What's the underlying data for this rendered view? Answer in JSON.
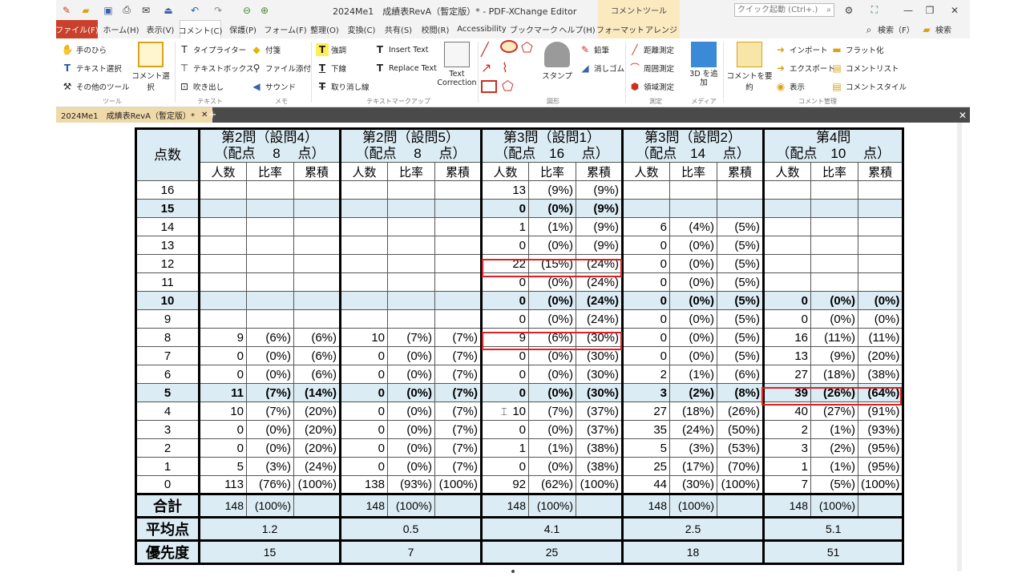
{
  "window": {
    "title": "2024Me1　成績表RevA（暫定版）* - PDF-XChange Editor",
    "context_label": "コメントツール",
    "quick_placeholder": "クイック起動 (Ctrl+.)"
  },
  "tabs": [
    {
      "label": "ファイル(F)"
    },
    {
      "label": "ホーム(H)"
    },
    {
      "label": "表示(V)"
    },
    {
      "label": "コメント(C)"
    },
    {
      "label": "保護(P)"
    },
    {
      "label": "フォーム(F)"
    },
    {
      "label": "整理(O)"
    },
    {
      "label": "変換(C)"
    },
    {
      "label": "共有(S)"
    },
    {
      "label": "校閲(R)"
    },
    {
      "label": "Accessibility"
    },
    {
      "label": "ブックマーク"
    },
    {
      "label": "ヘルプ(H)"
    },
    {
      "label": "フォーマット"
    },
    {
      "label": "アレンジ"
    }
  ],
  "tab_search1": "検索（F）",
  "tab_search2": "検索",
  "ribbon": {
    "tools": {
      "hand": "手のひら",
      "text_select": "テキスト選択",
      "other": "その他のツール",
      "comment_select": "コメント選択",
      "group": "ツール"
    },
    "text": {
      "typewriter": "タイプライター",
      "textbox": "テキストボックス",
      "callout": "吹き出し",
      "group": "テキスト"
    },
    "memo": {
      "note": "付箋",
      "attach": "ファイル添付",
      "sound": "サウンド",
      "group": "メモ"
    },
    "markup": {
      "highlight": "強調",
      "underline": "下線",
      "strike": "取り消し線",
      "insert": "Insert Text",
      "replace": "Replace Text",
      "correction": "Text Correction",
      "group": "テキストマークアップ"
    },
    "shapes": {
      "stamp": "スタンプ",
      "pencil": "鉛筆",
      "eraser": "消しゴム",
      "group": "図形"
    },
    "measure": {
      "distance": "距離測定",
      "perimeter": "周囲測定",
      "area": "領域測定",
      "group": "測定"
    },
    "media": {
      "add3d": "3D を追加",
      "group": "メディア"
    },
    "manage": {
      "summarize": "コメントを要約",
      "import": "インポート",
      "export": "エクスポート",
      "show": "表示",
      "flatten": "フラット化",
      "list": "コメントリスト",
      "style": "コメントスタイル",
      "group": "コメント管理"
    }
  },
  "doc_tab": "2024Me1　成績表RevA（暫定版）*",
  "table": {
    "corner": "点数",
    "sections": [
      {
        "title": "第2問（設問4）",
        "alloc": "（配点　 8　 点）"
      },
      {
        "title": "第2問（設問5）",
        "alloc": "（配点　 8　 点）"
      },
      {
        "title": "第3問（設問1）",
        "alloc": "（配点　16　 点）"
      },
      {
        "title": "第3問（設問2）",
        "alloc": "（配点　14　 点）"
      },
      {
        "title": "第4問",
        "alloc": "（配点　10　 点）"
      }
    ],
    "subheaders": [
      "人数",
      "比率",
      "累積"
    ],
    "rows": [
      {
        "score": "16",
        "hl": false,
        "cells": [
          "",
          "",
          "",
          "",
          "",
          "",
          "13",
          "(9%)",
          "(9%)",
          "",
          "",
          "",
          "",
          "",
          ""
        ]
      },
      {
        "score": "15",
        "hl": true,
        "cells": [
          "",
          "",
          "",
          "",
          "",
          "",
          "0",
          "(0%)",
          "(9%)",
          "",
          "",
          "",
          "",
          "",
          ""
        ]
      },
      {
        "score": "14",
        "hl": false,
        "cells": [
          "",
          "",
          "",
          "",
          "",
          "",
          "1",
          "(1%)",
          "(9%)",
          "6",
          "(4%)",
          "(5%)",
          "",
          "",
          ""
        ]
      },
      {
        "score": "13",
        "hl": false,
        "cells": [
          "",
          "",
          "",
          "",
          "",
          "",
          "0",
          "(0%)",
          "(9%)",
          "0",
          "(0%)",
          "(5%)",
          "",
          "",
          ""
        ]
      },
      {
        "score": "12",
        "hl": false,
        "cells": [
          "",
          "",
          "",
          "",
          "",
          "",
          "22",
          "(15%)",
          "(24%)",
          "0",
          "(0%)",
          "(5%)",
          "",
          "",
          ""
        ]
      },
      {
        "score": "11",
        "hl": false,
        "cells": [
          "",
          "",
          "",
          "",
          "",
          "",
          "0",
          "(0%)",
          "(24%)",
          "0",
          "(0%)",
          "(5%)",
          "",
          "",
          ""
        ]
      },
      {
        "score": "10",
        "hl": true,
        "cells": [
          "",
          "",
          "",
          "",
          "",
          "",
          "0",
          "(0%)",
          "(24%)",
          "0",
          "(0%)",
          "(5%)",
          "0",
          "(0%)",
          "(0%)"
        ]
      },
      {
        "score": "9",
        "hl": false,
        "cells": [
          "",
          "",
          "",
          "",
          "",
          "",
          "0",
          "(0%)",
          "(24%)",
          "0",
          "(0%)",
          "(5%)",
          "0",
          "(0%)",
          "(0%)"
        ]
      },
      {
        "score": "8",
        "hl": false,
        "cells": [
          "9",
          "(6%)",
          "(6%)",
          "10",
          "(7%)",
          "(7%)",
          "9",
          "(6%)",
          "(30%)",
          "0",
          "(0%)",
          "(5%)",
          "16",
          "(11%)",
          "(11%)"
        ]
      },
      {
        "score": "7",
        "hl": false,
        "cells": [
          "0",
          "(0%)",
          "(6%)",
          "0",
          "(0%)",
          "(7%)",
          "0",
          "(0%)",
          "(30%)",
          "0",
          "(0%)",
          "(5%)",
          "13",
          "(9%)",
          "(20%)"
        ]
      },
      {
        "score": "6",
        "hl": false,
        "cells": [
          "0",
          "(0%)",
          "(6%)",
          "0",
          "(0%)",
          "(7%)",
          "0",
          "(0%)",
          "(30%)",
          "2",
          "(1%)",
          "(6%)",
          "27",
          "(18%)",
          "(38%)"
        ]
      },
      {
        "score": "5",
        "hl": true,
        "cells": [
          "11",
          "(7%)",
          "(14%)",
          "0",
          "(0%)",
          "(7%)",
          "0",
          "(0%)",
          "(30%)",
          "3",
          "(2%)",
          "(8%)",
          "39",
          "(26%)",
          "(64%)"
        ]
      },
      {
        "score": "4",
        "hl": false,
        "cells": [
          "10",
          "(7%)",
          "(20%)",
          "0",
          "(0%)",
          "(7%)",
          "10",
          "(7%)",
          "(37%)",
          "27",
          "(18%)",
          "(26%)",
          "40",
          "(27%)",
          "(91%)"
        ]
      },
      {
        "score": "3",
        "hl": false,
        "cells": [
          "0",
          "(0%)",
          "(20%)",
          "0",
          "(0%)",
          "(7%)",
          "0",
          "(0%)",
          "(37%)",
          "35",
          "(24%)",
          "(50%)",
          "2",
          "(1%)",
          "(93%)"
        ]
      },
      {
        "score": "2",
        "hl": false,
        "cells": [
          "0",
          "(0%)",
          "(20%)",
          "0",
          "(0%)",
          "(7%)",
          "1",
          "(1%)",
          "(38%)",
          "5",
          "(3%)",
          "(53%)",
          "3",
          "(2%)",
          "(95%)"
        ]
      },
      {
        "score": "1",
        "hl": false,
        "cells": [
          "5",
          "(3%)",
          "(24%)",
          "0",
          "(0%)",
          "(7%)",
          "0",
          "(0%)",
          "(38%)",
          "25",
          "(17%)",
          "(70%)",
          "1",
          "(1%)",
          "(95%)"
        ]
      },
      {
        "score": "0",
        "hl": false,
        "cells": [
          "113",
          "(76%)",
          "(100%)",
          "138",
          "(93%)",
          "(100%)",
          "92",
          "(62%)",
          "(100%)",
          "44",
          "(30%)",
          "(100%)",
          "7",
          "(5%)",
          "(100%)"
        ]
      }
    ],
    "total_label": "合計",
    "totals": [
      [
        "148",
        "(100%)"
      ],
      [
        "148",
        "(100%)"
      ],
      [
        "148",
        "(100%)"
      ],
      [
        "148",
        "(100%)"
      ],
      [
        "148",
        "(100%)"
      ]
    ],
    "avg_label": "平均点",
    "averages": [
      "1.2",
      "0.5",
      "4.1",
      "2.5",
      "5.1"
    ],
    "priority_label": "優先度",
    "priorities": [
      "15",
      "7",
      "25",
      "18",
      "51"
    ]
  }
}
